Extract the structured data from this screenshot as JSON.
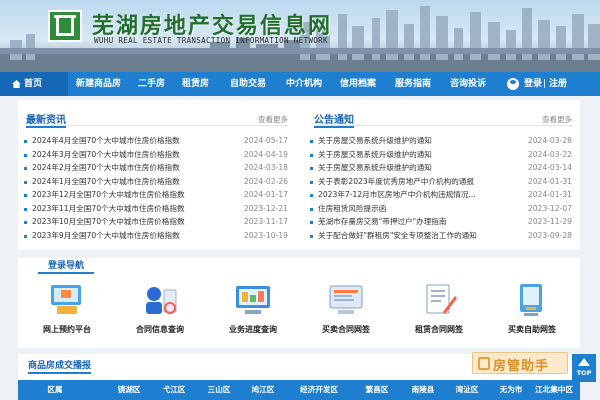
{
  "header": {
    "site_title": "芜湖房地产交易信息网",
    "site_subtitle": "WUHU REAL ESTATE TRANSACTION INFORMATION NETWORK"
  },
  "nav": {
    "items": [
      "首页",
      "新建商品房",
      "二手房",
      "租赁房",
      "自助交易",
      "中介机构",
      "信用档案",
      "服务指南",
      "咨询投诉"
    ],
    "login": "登录",
    "separator": "|",
    "register": "注册"
  },
  "news": {
    "title": "最新资讯",
    "more": "查看更多",
    "items": [
      {
        "title": "2024年4月全国70个大中城市住房价格指数",
        "date": "2024-05-17"
      },
      {
        "title": "2024年3月全国70个大中城市住房价格指数",
        "date": "2024-04-19"
      },
      {
        "title": "2024年2月全国70个大中城市住房价格指数",
        "date": "2024-03-18"
      },
      {
        "title": "2024年1月全国70个大中城市住房价格指数",
        "date": "2024-02-26"
      },
      {
        "title": "2023年12月全国70个大中城市住房价格指数",
        "date": "2024-01-17"
      },
      {
        "title": "2023年11月全国70个大中城市住房价格指数",
        "date": "2023-12-21"
      },
      {
        "title": "2023年10月全国70个大中城市住房价格指数",
        "date": "2023-11-17"
      },
      {
        "title": "2023年9月全国70个大中城市住房价格指数",
        "date": "2023-10-19"
      }
    ]
  },
  "notices": {
    "title": "公告通知",
    "more": "查看更多",
    "items": [
      {
        "title": "关于房屋交易系统升级维护的通知",
        "date": "2024-03-28"
      },
      {
        "title": "关于房屋交易系统升级维护的通知",
        "date": "2024-03-22"
      },
      {
        "title": "关于房屋交易系统升级维护的通知",
        "date": "2024-03-14"
      },
      {
        "title": "关于表彰2023年度优秀房地产中介机构的通报",
        "date": "2024-01-31"
      },
      {
        "title": "2023年7-12月市区房地产中介机构违规情况...",
        "date": "2024-01-31"
      },
      {
        "title": "住房租赁风险提示函",
        "date": "2023-12-07"
      },
      {
        "title": "芜湖市存量房交易\"带押过户\"办理指南",
        "date": "2023-11-29"
      },
      {
        "title": "关于配合做好\"群租房\"安全专项整治工作的通知",
        "date": "2023-09-28"
      }
    ]
  },
  "guide": {
    "title": "登录导航",
    "items": [
      "网上预约平台",
      "合同信息查询",
      "业务进度查询",
      "买卖合同网签",
      "租赁合同网签",
      "买卖自助网签"
    ]
  },
  "trade": {
    "title": "商品房成交播报",
    "columns": [
      "区属",
      "镜湖区",
      "弋江区",
      "三山区",
      "鸠江区",
      "经济开发区",
      "繁昌区",
      "南陵县",
      "湾沚区",
      "无为市",
      "江北集中区"
    ]
  },
  "helper": {
    "text": "房管助手"
  },
  "top_button": {
    "label": "TOP"
  },
  "colors": {
    "nav": "#1e7fd0",
    "accent": "#1565b8",
    "logo": "#2e8b3a"
  }
}
